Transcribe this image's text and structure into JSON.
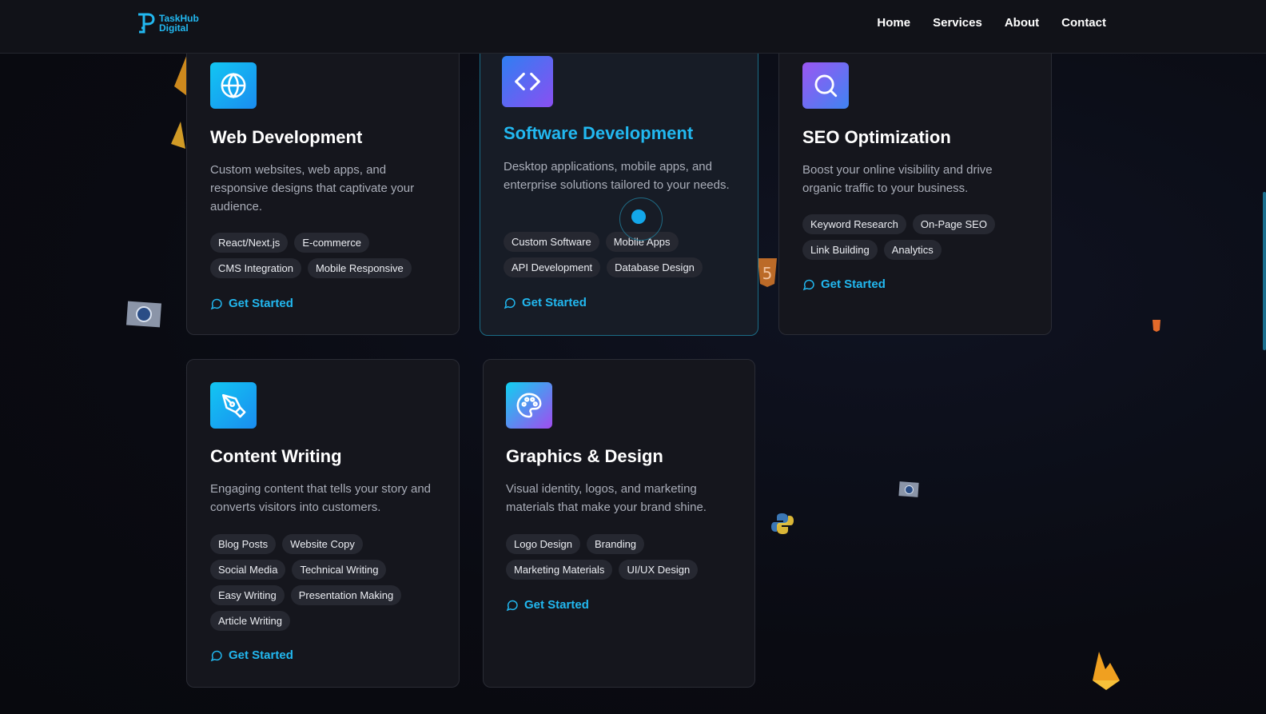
{
  "brand": {
    "line1": "TaskHub",
    "line2": "Digital"
  },
  "nav": {
    "home": "Home",
    "services": "Services",
    "about": "About",
    "contact": "Contact"
  },
  "colors": {
    "accent": "#22b8f0",
    "card_bg": "#15161d",
    "page_bg": "#0b0c12"
  },
  "cards": [
    {
      "title": "Web Development",
      "icon": "globe-icon",
      "description": "Custom websites, web apps, and responsive designs that captivate your audience.",
      "tags": [
        "React/Next.js",
        "E-commerce",
        "CMS Integration",
        "Mobile Responsive"
      ],
      "cta": "Get Started"
    },
    {
      "title": "Software Development",
      "icon": "code-icon",
      "description": "Desktop applications, mobile apps, and enterprise solutions tailored to your needs.",
      "tags": [
        "Custom Software",
        "Mobile Apps",
        "API Development",
        "Database Design"
      ],
      "cta": "Get Started"
    },
    {
      "title": "SEO Optimization",
      "icon": "search-icon",
      "description": "Boost your online visibility and drive organic traffic to your business.",
      "tags": [
        "Keyword Research",
        "On-Page SEO",
        "Link Building",
        "Analytics"
      ],
      "cta": "Get Started"
    },
    {
      "title": "Content Writing",
      "icon": "pen-tool-icon",
      "description": "Engaging content that tells your story and converts visitors into customers.",
      "tags": [
        "Blog Posts",
        "Website Copy",
        "Social Media",
        "Technical Writing",
        "Easy Writing",
        "Presentation Making",
        "Article Writing"
      ],
      "cta": "Get Started"
    },
    {
      "title": "Graphics & Design",
      "icon": "palette-icon",
      "description": "Visual identity, logos, and marketing materials that make your brand shine.",
      "tags": [
        "Logo Design",
        "Branding",
        "Marketing Materials",
        "UI/UX Design"
      ],
      "cta": "Get Started"
    }
  ]
}
